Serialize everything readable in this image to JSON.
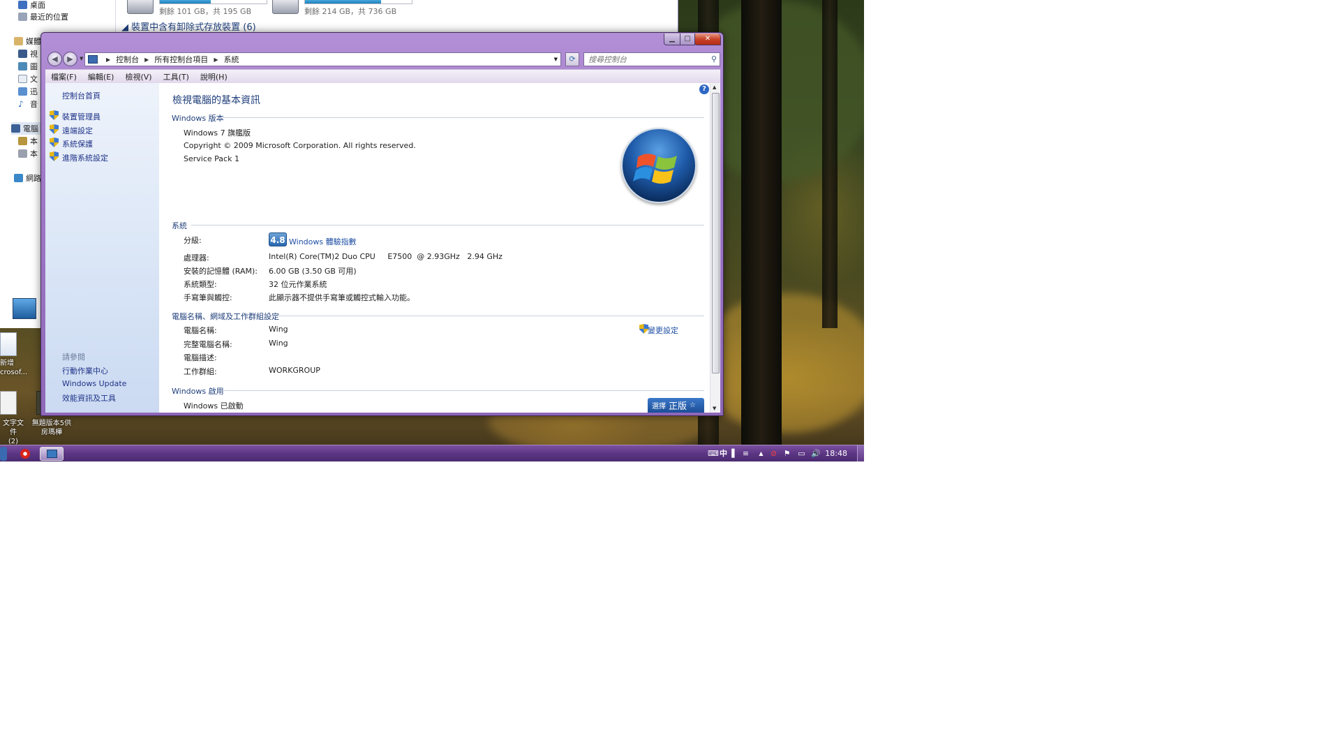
{
  "explorer": {
    "nav": {
      "desktop": "桌面",
      "recent": "最近的位置",
      "libraries": "媒體",
      "videos": "視",
      "pictures": "圖",
      "documents": "文",
      "thunder": "迅",
      "music": "音",
      "computer": "電腦",
      "local1": "本",
      "local2": "本",
      "network": "網路"
    },
    "drives": [
      {
        "free_text": "剩餘 101 GB，共 195 GB",
        "used_fraction": 0.48
      },
      {
        "free_text": "剩餘 214 GB，共 736 GB",
        "used_fraction": 0.71
      }
    ],
    "removable_header": "裝置中含有卸除式存放裝置 (6)"
  },
  "desktop_icons": {
    "new_doc": "新增",
    "new_doc2": "crosof...",
    "text_doc": "文字文件",
    "text_doc2": "(2)",
    "shortcut": "無題版本5供",
    "shortcut2": "房瑪樺"
  },
  "address": {
    "crumbs": [
      "控制台",
      "所有控制台項目",
      "系統"
    ],
    "search_placeholder": "搜尋控制台"
  },
  "menu": [
    "檔案(F)",
    "編輯(E)",
    "檢視(V)",
    "工具(T)",
    "說明(H)"
  ],
  "left_pane": {
    "home": "控制台首頁",
    "tasks": [
      "裝置管理員",
      "遠端設定",
      "系統保護",
      "進階系統設定"
    ],
    "see_also_heading": "請參閱",
    "see_also": [
      "行動作業中心",
      "Windows Update",
      "效能資訊及工具"
    ]
  },
  "content": {
    "title": "檢視電腦的基本資訊",
    "edition_header": "Windows 版本",
    "edition": "Windows 7 旗艦版",
    "copyright": "Copyright © 2009 Microsoft Corporation.  All rights reserved.",
    "service_pack": "Service Pack 1",
    "system_header": "系統",
    "rating_label": "分級:",
    "rating_score": "4.8",
    "rating_link": "Windows 體驗指數",
    "processor_label": "處理器:",
    "processor_value": "Intel(R) Core(TM)2 Duo CPU     E7500  @ 2.93GHz   2.94 GHz",
    "ram_label": "安裝的記憶體 (RAM):",
    "ram_value": "6.00 GB (3.50 GB 可用)",
    "systype_label": "系統類型:",
    "systype_value": "32 位元作業系統",
    "pen_label": "手寫筆與觸控:",
    "pen_value": "此顯示器不提供手寫筆或觸控式輸入功能。",
    "computer_header": "電腦名稱、網域及工作群組設定",
    "change_settings": "變更設定",
    "name_label": "電腦名稱:",
    "name_value": "Wing",
    "fullname_label": "完整電腦名稱:",
    "fullname_value": "Wing",
    "desc_label": "電腦描述:",
    "workgroup_label": "工作群組:",
    "workgroup_value": "WORKGROUP",
    "activation_header": "Windows 啟用",
    "activated": "Windows 已啟動",
    "genuine_a": "選擇",
    "genuine_b": "正版"
  },
  "taskbar": {
    "time": "18:48",
    "ime": "中"
  },
  "colors": {
    "title_bar": "#9f78c6",
    "taskbar": "#5c3684",
    "link_blue": "#1e4ea3",
    "section_blue": "#1e3e7a"
  }
}
